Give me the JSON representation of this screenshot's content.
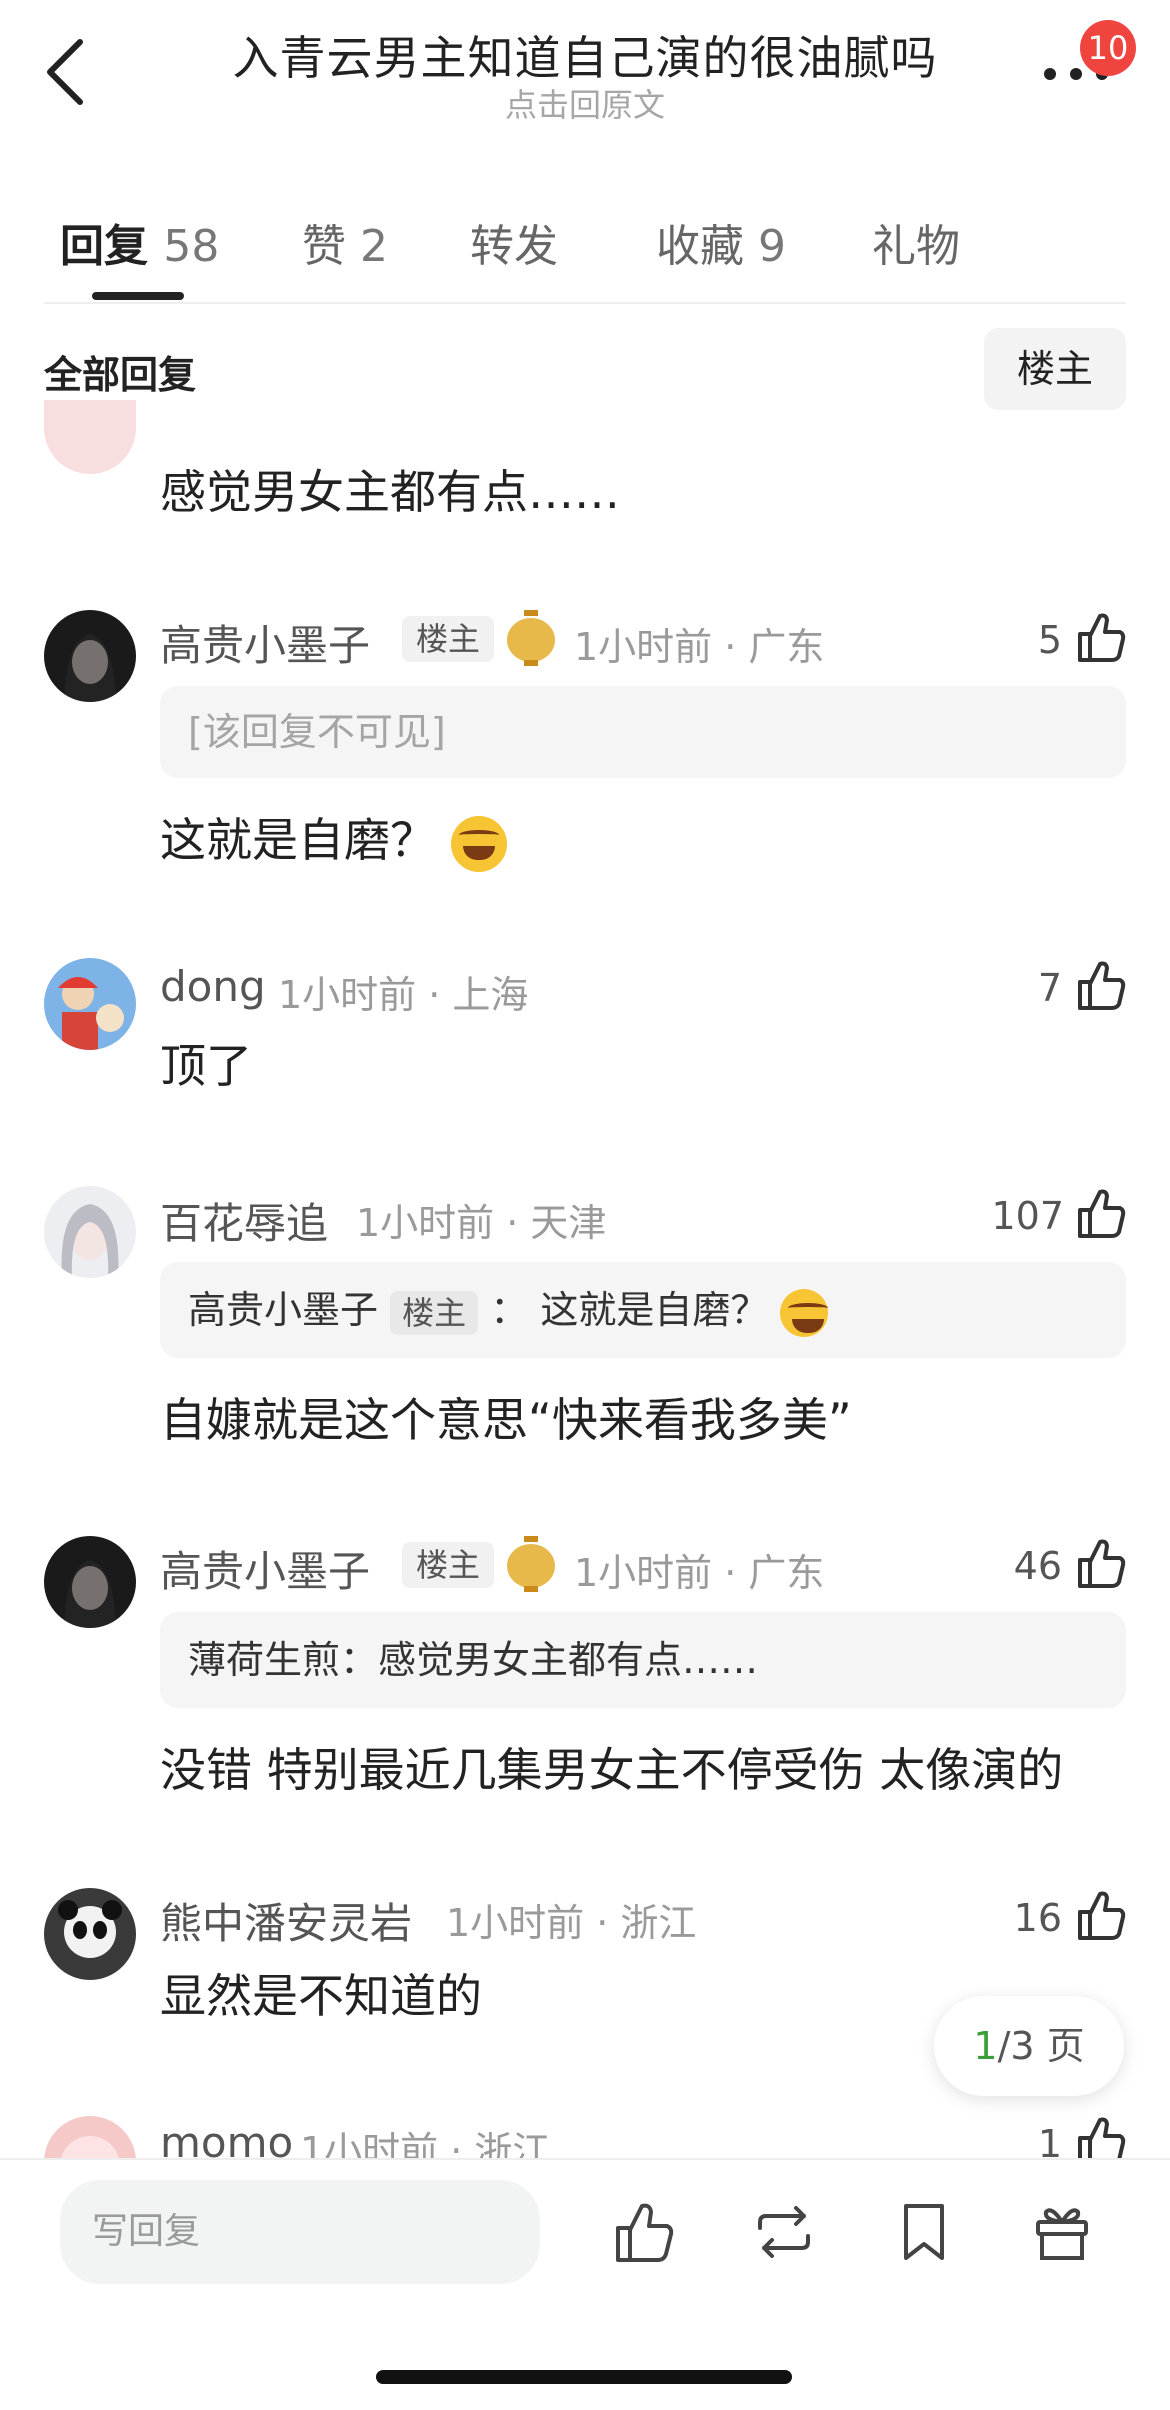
{
  "header": {
    "title": "入青云男主知道自己演的很油腻吗",
    "subtitle": "点击回原文",
    "badge_count": "10"
  },
  "tabs": [
    {
      "label": "回复",
      "count": "58",
      "active": true
    },
    {
      "label": "赞",
      "count": "2",
      "active": false
    },
    {
      "label": "转发",
      "count": "",
      "active": false
    },
    {
      "label": "收藏",
      "count": "9",
      "active": false
    },
    {
      "label": "礼物",
      "count": "",
      "active": false
    }
  ],
  "filter": {
    "title": "全部回复",
    "op_button": "楼主"
  },
  "comments": [
    {
      "content": "感觉男女主都有点……"
    },
    {
      "name": "高贵小墨子",
      "op_tag": "楼主",
      "time": "1小时前 · 广东",
      "likes": "5",
      "quote": "[该回复不可见]",
      "content": "这就是自磨？"
    },
    {
      "name": "dong",
      "time": "1小时前 · 上海",
      "likes": "7",
      "content": "顶了"
    },
    {
      "name": "百花辱追",
      "time": "1小时前 · 天津",
      "likes": "107",
      "quote_user": "高贵小墨子",
      "quote_tag": "楼主",
      "quote_sep": "：",
      "quote_text": "这就是自磨？",
      "content": "自嫝就是这个意思“快来看我多美”"
    },
    {
      "name": "高贵小墨子",
      "op_tag": "楼主",
      "time": "1小时前 · 广东",
      "likes": "46",
      "quote": "薄荷生煎：感觉男女主都有点……",
      "content": "没错 特别最近几集男女主不停受伤 太像演的"
    },
    {
      "name": "熊中潘安灵岩",
      "time": "1小时前 · 浙江",
      "likes": "16",
      "content": "显然是不知道的"
    },
    {
      "name": "momo",
      "time": "1小时前 · 浙江",
      "likes": "1"
    }
  ],
  "pagination": {
    "current": "1",
    "total_text": "/3 页"
  },
  "bottom": {
    "reply_placeholder": "写回复"
  },
  "colors": {
    "accent_green": "#3b9e3b",
    "badge_red": "#f0453f"
  }
}
